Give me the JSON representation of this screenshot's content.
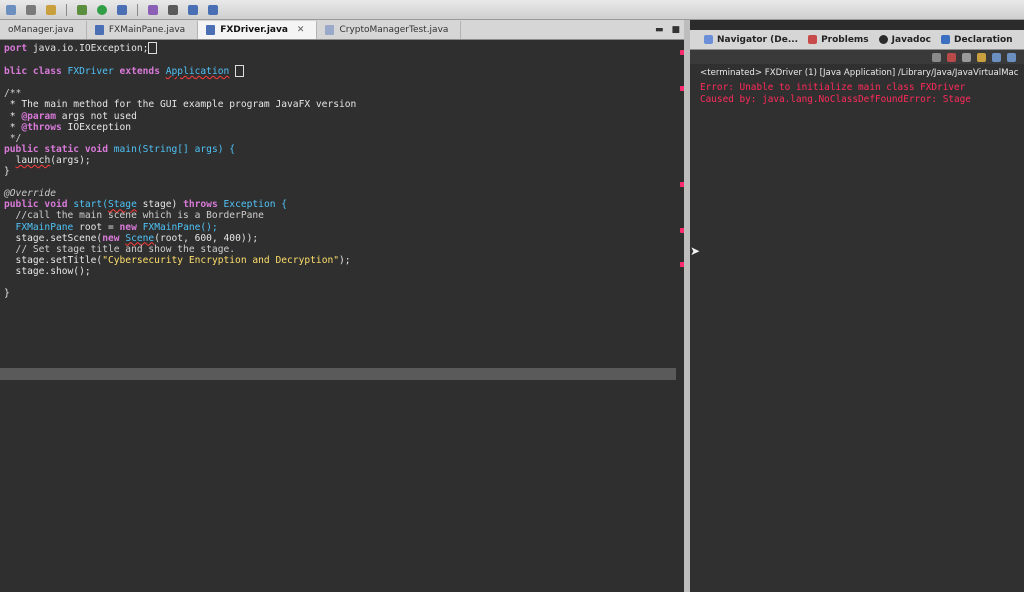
{
  "editor": {
    "tabs": [
      {
        "label": "oManager.java",
        "active": false
      },
      {
        "label": "FXMainPane.java",
        "active": false
      },
      {
        "label": "FXDriver.java",
        "active": true,
        "close": "✕"
      },
      {
        "label": "CryptoManagerTest.java",
        "active": false
      }
    ],
    "code": {
      "l1_a": "port ",
      "l1_b": "java.io.IOException;",
      "l2_a": "blic class ",
      "l2_b": "FXDriver",
      "l2_c": " extends ",
      "l2_d": "Application",
      "l3": "/**",
      "l4": " * The main method for the GUI example program JavaFX version",
      "l5_a": " * ",
      "l5_b": "@param",
      "l5_c": " args not used",
      "l6_a": " * ",
      "l6_b": "@throws",
      "l6_c": " IOException",
      "l7": " */",
      "l8_a": "public static void ",
      "l8_b": "main(String[] args) {",
      "l9_a": "launch",
      "l9_b": "(args);",
      "l10": "}",
      "l11": "@Override",
      "l12_a": "public void ",
      "l12_b": "start(",
      "l12_c": "Stage",
      "l12_d": " stage) ",
      "l12_e": "throws ",
      "l12_f": "Exception {",
      "l13": "  //call the main scene which is a BorderPane",
      "l14_a": "  FXMainPane ",
      "l14_b": "root",
      "l14_c": " = ",
      "l14_d": "new ",
      "l14_e": "FXMainPane();",
      "l15_a": "  stage.setScene(",
      "l15_b": "new ",
      "l15_c": "Scene",
      "l15_d": "(root, 600, 400));",
      "l16": "  // Set stage title and show the stage.",
      "l17_a": "  stage.setTitle(",
      "l17_b": "\"Cybersecurity Encryption and Decryption\"",
      "l17_c": ");",
      "l18": "  stage.show();",
      "l19": "}"
    }
  },
  "right_panel": {
    "tabs": [
      {
        "label": "Navigator (De...",
        "icon_color": "#6a8fd8"
      },
      {
        "label": "Problems",
        "icon_color": "#c94a4a"
      },
      {
        "label": "Javadoc",
        "icon_color": "#2b2b2b"
      },
      {
        "label": "Declaration",
        "icon_color": "#3c6fc1"
      }
    ],
    "console": {
      "header": "<terminated> FXDriver (1) [Java Application] /Library/Java/JavaVirtualMac",
      "error_line_1": "Error: Unable to initialize main class FXDriver",
      "error_line_2": "Caused by: java.lang.NoClassDefFoundError: Stage"
    }
  },
  "colors": {
    "keyword": "#d97ad9",
    "type": "#4fc3f7",
    "string": "#ffdf6b",
    "error": "#ff2a5a"
  }
}
